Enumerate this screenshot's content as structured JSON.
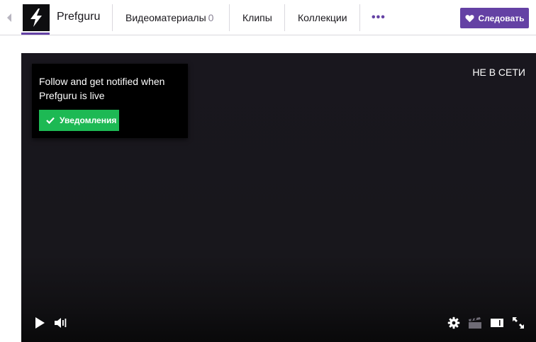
{
  "header": {
    "back_icon": "chevron-left-icon",
    "channel_name": "Prefguru",
    "nav": [
      {
        "label": "Видеоматериалы",
        "count": "0"
      },
      {
        "label": "Клипы"
      },
      {
        "label": "Коллекции"
      }
    ],
    "more_icon": "more-dots-icon",
    "follow_label": "Следовать",
    "accent_color": "#6441a4"
  },
  "player": {
    "status": "НЕ В СЕТИ",
    "notify_card": {
      "text": "Follow and get notified when Prefguru is live",
      "button_label": "Уведомления",
      "button_color": "#1db954"
    },
    "controls": [
      "play-icon",
      "volume-icon",
      "settings-icon",
      "clip-icon",
      "theatre-mode-icon",
      "fullscreen-icon"
    ]
  }
}
